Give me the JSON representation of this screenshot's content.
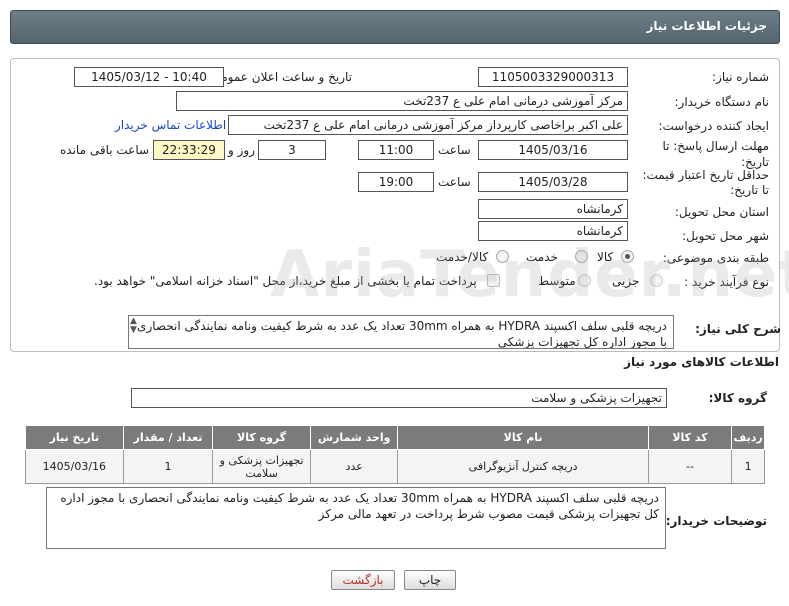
{
  "header": {
    "title": "جزئیات اطلاعات نیاز"
  },
  "form": {
    "need_number_label": "شماره نیاز:",
    "need_number": "1105003329000313",
    "announce_label": "تاریخ و ساعت اعلان عمومی:",
    "announce_value": "1405/03/12 - 10:40",
    "buyer_org_label": "نام دستگاه خریدار:",
    "buyer_org": "مرکز آموزشی درمانی امام علی ع 237تخت",
    "requester_label": "ایجاد کننده درخواست:",
    "requester": "علی اکبر براخاصی کارپرداز  مرکز آموزشی درمانی امام علی ع 237تخت",
    "contact_link": "اطلاعات تماس خریدار",
    "reply_deadline_label": "مهلت ارسال پاسخ: تا تاریخ:",
    "reply_date": "1405/03/16",
    "time_label": "ساعت",
    "reply_time": "11:00",
    "days_value": "3",
    "days_label": "روز و",
    "remaining_time": "22:33:29",
    "remaining_label": "ساعت باقی مانده",
    "validity_label_1": "حداقل تاریخ اعتبار قیمت:",
    "validity_label_2": "تا تاریخ:",
    "validity_date": "1405/03/28",
    "validity_time": "19:00",
    "province_label": "استان محل تحویل:",
    "province": "کرمانشاه",
    "city_label": "شهر محل تحویل:",
    "city": "کرمانشاه",
    "category_label": "طبقه بندی موضوعی:",
    "category_options": [
      "کالا",
      "خدمت",
      "کالا/خدمت"
    ],
    "category_selected": "کالا",
    "process_label": "نوع فرآیند خرید :",
    "process_options": [
      "جزیی",
      "متوسط"
    ],
    "payment_note": "پرداخت تمام یا بخشی از مبلغ خرید،از محل \"اسناد خزانه اسلامی\" خواهد بود."
  },
  "summary": {
    "label": "شرح کلی نیاز:",
    "text": "دریچه قلبی سلف اکسپند HYDRA به همراه 30mm تعداد یک عدد به شرط کیفیت ونامه نمایندگی انحصاری با مجوز اداره کل تجهیزات پزشکی"
  },
  "goods": {
    "section_title": "اطلاعات کالاهای مورد نیاز",
    "group_label": "گروه کالا:",
    "group_value": "تجهیزات پزشکی و سلامت",
    "columns": [
      "ردیف",
      "کد کالا",
      "نام کالا",
      "واحد شمارش",
      "گروه کالا",
      "تعداد / مقدار",
      "تاریخ نیاز"
    ],
    "rows": [
      {
        "row": "1",
        "code": "--",
        "name": "دریچه کنترل آنژیوگرافی",
        "unit": "عدد",
        "group": "تجهیزات پزشکی و سلامت",
        "qty": "1",
        "date": "1405/03/16"
      }
    ]
  },
  "buyer_notes": {
    "label": "توضیحات خریدار:",
    "text": "دریچه قلبی سلف اکسپند HYDRA به همراه 30mm تعداد یک عدد به شرط کیفیت ونامه نمایندگی انحصاری با مجوز اداره کل تجهیزات پزشکی قیمت مصوب شرط پرداخت در تعهد مالی مرکز"
  },
  "buttons": {
    "print": "چاپ",
    "back": "بازگشت"
  },
  "watermark": "AriaTender.net"
}
